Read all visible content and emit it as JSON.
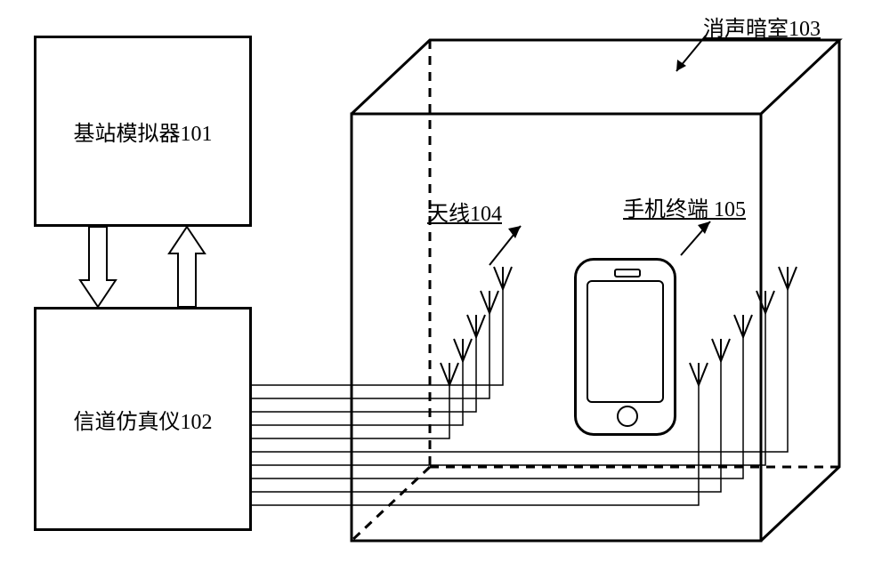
{
  "labels": {
    "base_station_simulator": "基站模拟器101",
    "channel_emulator": "信道仿真仪102",
    "anechoic_chamber": "消声暗室103",
    "antenna": "天线104",
    "phone_terminal": "手机终端 105"
  }
}
